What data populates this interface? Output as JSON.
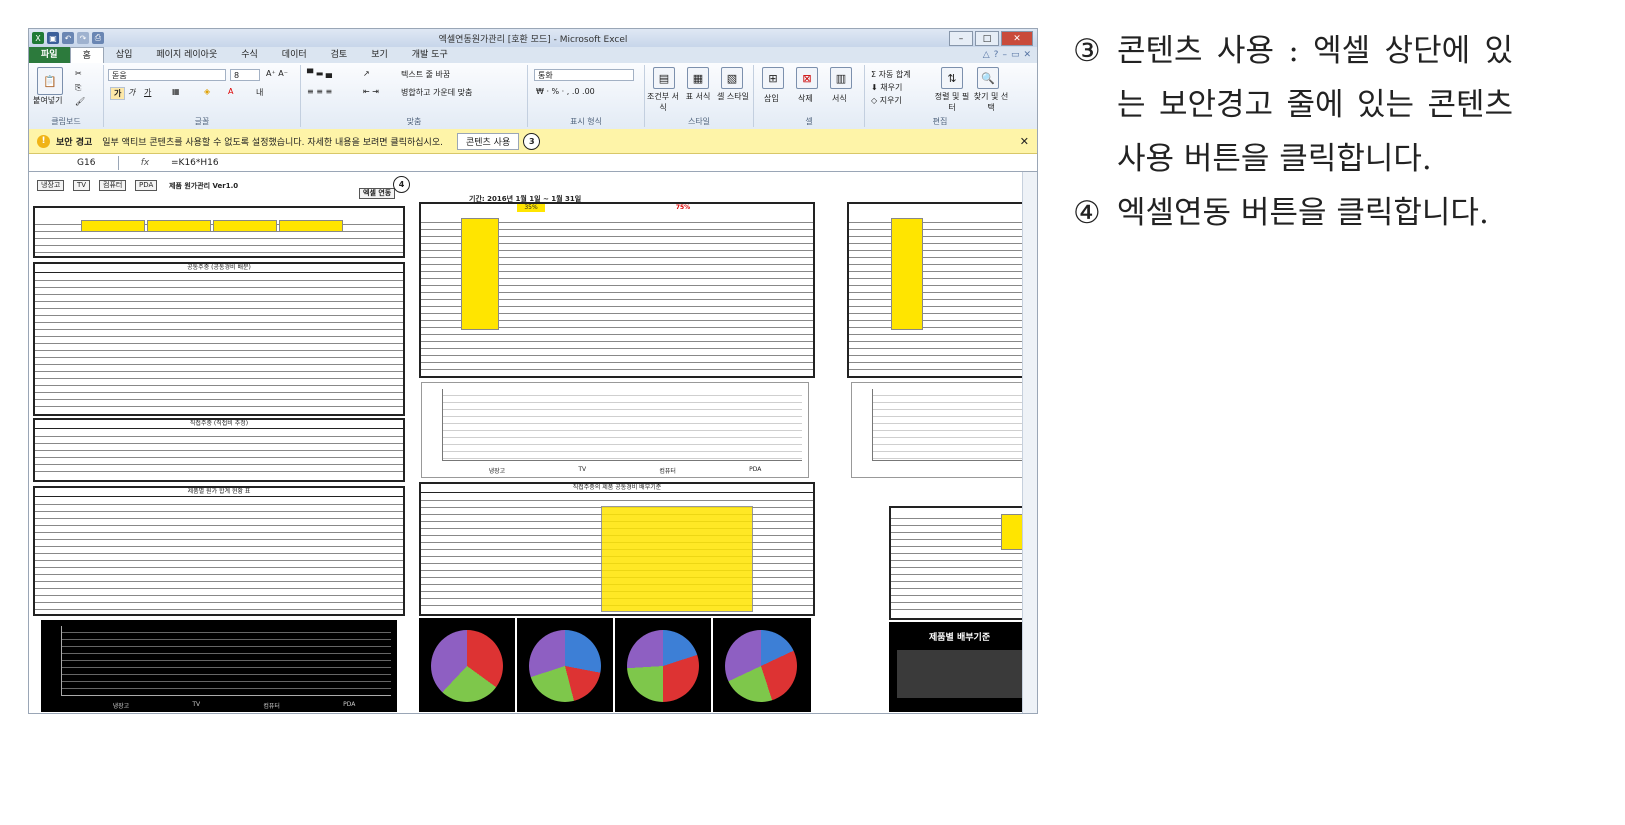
{
  "excel": {
    "window_title": "엑셀연동원가관리 [호환 모드] - Microsoft Excel",
    "tabs": [
      "파일",
      "홈",
      "삽입",
      "페이지 레이아웃",
      "수식",
      "데이터",
      "검토",
      "보기",
      "개발 도구"
    ],
    "active_tab": "홈",
    "ribbon": {
      "font_name": "돋움",
      "font_size": "8",
      "paste_label": "붙여넣기",
      "wrap_text": "텍스트 줄 바꿈",
      "merge_center": "병합하고 가운데 맞춤",
      "number_format": "통화",
      "conditional_format": "조건부 서식",
      "table_format": "표 서식",
      "cell_style": "셀 스타일",
      "insert": "삽입",
      "delete": "삭제",
      "format": "서식",
      "autosum": "자동 합계",
      "fill": "채우기",
      "clear": "지우기",
      "sort_filter": "정렬 및 필터",
      "find_select": "찾기 및 선택",
      "groups": [
        "클립보드",
        "글꼴",
        "맞춤",
        "표시 형식",
        "스타일",
        "셀",
        "편집"
      ]
    },
    "security_bar": {
      "label": "보안 경고",
      "message": "일부 액티브 콘텐츠를 사용할 수 없도록 설정했습니다. 자세한 내용을 보려면 클릭하십시오.",
      "button": "콘텐츠 사용",
      "callout": "3"
    },
    "formula_bar": {
      "cell_ref": "G16",
      "fx": "fx",
      "formula": "=K16*H16"
    },
    "sheet": {
      "tabs_row": [
        "냉장고",
        "TV",
        "컴퓨터",
        "PDA"
      ],
      "sheet_title": "제품 원가관리 Ver1.0",
      "excel_button": "엑셀 연동",
      "callout": "4",
      "period": "기간: 2016년 1월 1일 ~ 1월 31일",
      "pct_a": "35%",
      "pct_b": "75%",
      "section_titles": [
        "공통주중 (공통경비 배분)",
        "직접주중 (직접비 추정)",
        "제품별 원가 합계 현황 표",
        "직접주중의 제품 공통경비 배부기준"
      ],
      "chart_label": "제품별 배부기준",
      "x_categories": [
        "냉장고",
        "TV",
        "컴퓨터",
        "PDA"
      ]
    }
  },
  "notes": [
    {
      "marker": "③",
      "text": "콘텐츠 사용 : 엑셀 상단에 있는 보안경고 줄에 있는 콘텐츠 사용 버튼을 클릭합니다."
    },
    {
      "marker": "④",
      "text": "엑셀연동 버튼을 클릭합니다."
    }
  ]
}
